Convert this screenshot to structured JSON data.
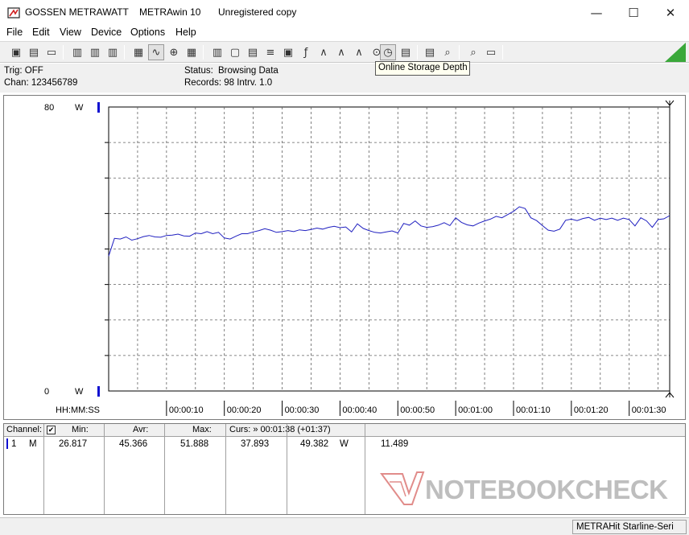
{
  "window": {
    "vendor": "GOSSEN METRAWATT",
    "app": "METRAwin 10",
    "license": "Unregistered copy",
    "controls": {
      "minimize": "—",
      "maximize": "☐",
      "close": "✕"
    }
  },
  "menu": [
    "File",
    "Edit",
    "View",
    "Device",
    "Options",
    "Help"
  ],
  "toolbar": {
    "tooltip": "Online Storage Depth",
    "icons": [
      "open-icon",
      "save-icon",
      "folder-icon",
      "device-icon",
      "device-icon",
      "device-icon",
      "keyboard-icon",
      "graph-icon",
      "crosshair-icon",
      "table-icon",
      "chart-icon",
      "window-icon",
      "print-icon",
      "list-icon",
      "computer-icon",
      "signal-icon",
      "wave-icon",
      "wave-icon",
      "wave-icon",
      "search-icon",
      "clock-icon",
      "printer-icon",
      "printer-icon",
      "zoom-icon",
      "zoom-icon",
      "message-icon"
    ]
  },
  "info": {
    "trig": "Trig: OFF",
    "chan": "Chan:  123456789",
    "status_label": "Status:",
    "status_value": "Browsing Data",
    "records": "Records: 98   Intrv. 1.0"
  },
  "chart_data": {
    "type": "line",
    "ylabel": "W",
    "y_top_label": "80",
    "y_bottom_label": "0",
    "ylim": [
      0,
      80
    ],
    "xlim": [
      0,
      97
    ],
    "x_axis_label": "HH:MM:SS",
    "tick_labels": [
      "00:00:10",
      "00:00:20",
      "00:00:30",
      "00:00:40",
      "00:00:50",
      "00:01:00",
      "00:01:10",
      "00:01:20",
      "00:01:30"
    ],
    "tick_values": [
      10,
      20,
      30,
      40,
      50,
      60,
      70,
      80,
      90
    ],
    "grid": true,
    "series": [
      {
        "color": "#2020c0",
        "x": [
          0,
          1,
          2,
          3,
          4,
          5,
          6,
          7,
          8,
          9,
          10,
          11,
          12,
          13,
          14,
          15,
          16,
          17,
          18,
          19,
          20,
          21,
          22,
          23,
          24,
          25,
          26,
          27,
          28,
          29,
          30,
          31,
          32,
          33,
          34,
          35,
          36,
          37,
          38,
          39,
          40,
          41,
          42,
          43,
          44,
          45,
          46,
          47,
          48,
          49,
          50,
          51,
          52,
          53,
          54,
          55,
          56,
          57,
          58,
          59,
          60,
          61,
          62,
          63,
          64,
          65,
          66,
          67,
          68,
          69,
          70,
          71,
          72,
          73,
          74,
          75,
          76,
          77,
          78,
          79,
          80,
          81,
          82,
          83,
          84,
          85,
          86,
          87,
          88,
          89,
          90,
          91,
          92,
          93,
          94,
          95,
          96,
          97
        ],
        "values": [
          38.0,
          43.0,
          42.8,
          43.4,
          42.5,
          42.9,
          43.5,
          43.8,
          43.4,
          43.3,
          43.8,
          43.9,
          44.2,
          43.7,
          43.6,
          44.5,
          44.3,
          44.9,
          44.3,
          44.7,
          43.1,
          42.8,
          43.6,
          44.3,
          44.3,
          44.8,
          45.2,
          45.7,
          45.3,
          44.7,
          44.9,
          45.2,
          44.9,
          45.4,
          45.2,
          45.5,
          45.9,
          45.6,
          46.1,
          46.4,
          46.0,
          46.2,
          44.8,
          47.1,
          45.8,
          45.2,
          44.7,
          44.5,
          44.8,
          45.1,
          44.5,
          47.2,
          46.7,
          47.9,
          46.5,
          46.1,
          46.3,
          46.7,
          47.4,
          46.6,
          48.8,
          47.5,
          46.8,
          46.5,
          47.3,
          47.9,
          48.4,
          49.2,
          48.8,
          49.7,
          50.6,
          51.9,
          51.4,
          48.8,
          48.0,
          46.6,
          45.3,
          45.0,
          45.6,
          48.1,
          48.4,
          48.0,
          48.6,
          48.9,
          48.1,
          48.7,
          48.3,
          48.7,
          48.1,
          48.7,
          48.3,
          46.5,
          48.8,
          47.9,
          46.1,
          48.3,
          48.5,
          49.4
        ]
      }
    ]
  },
  "table": {
    "headers": {
      "channel": "Channel:",
      "min": "Min:",
      "avr": "Avr:",
      "max": "Max:",
      "curs": "Curs: » 00:01:38 (+01:37)"
    },
    "checkbox": "✔",
    "row": {
      "channel_no": "1",
      "channel_unit": "M",
      "min": "26.817",
      "avr": "45.366",
      "max": "51.888",
      "curs_a": "37.893",
      "curs_b": "49.382",
      "unit": "W",
      "extra": "11.489"
    }
  },
  "watermark": "NOTEBOOKCHECK",
  "statusbar": {
    "device": "METRAHit Starline-Seri"
  }
}
